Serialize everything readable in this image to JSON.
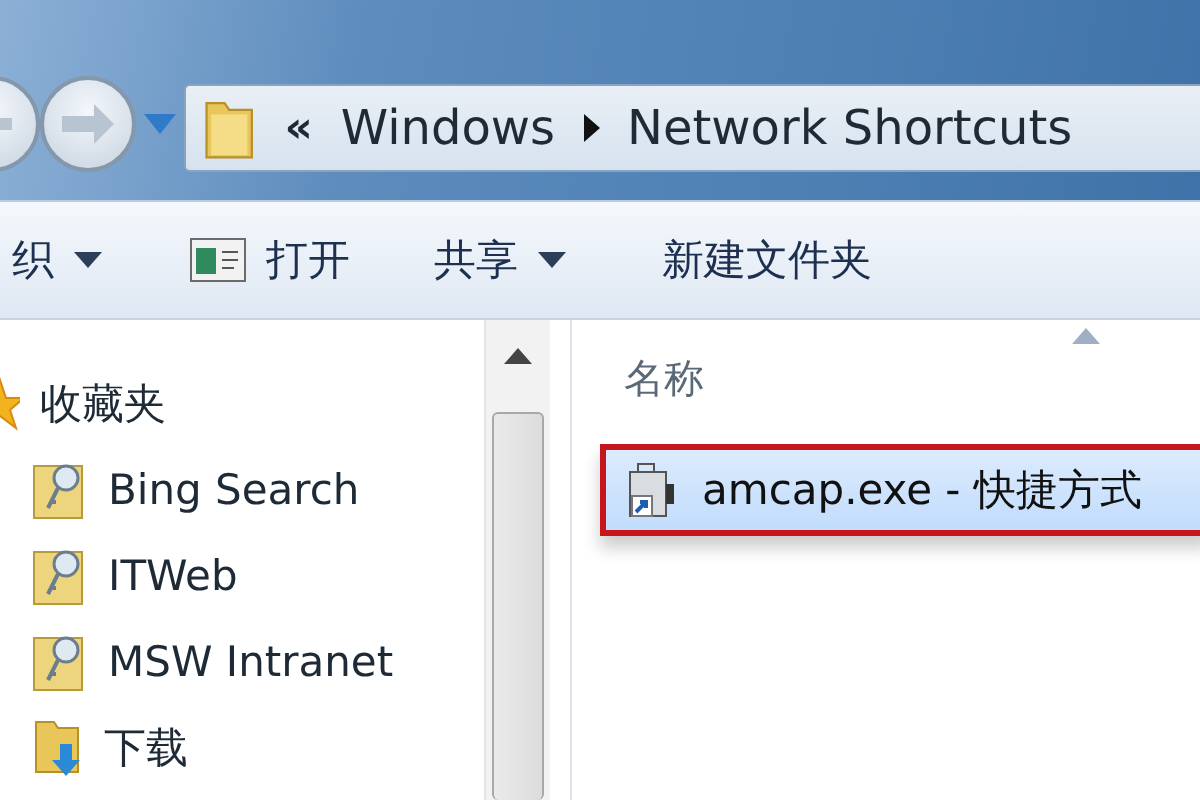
{
  "address_bar": {
    "overflow": "«",
    "crumbs": [
      "Windows",
      "Network Shortcuts"
    ]
  },
  "toolbar": [
    {
      "label": "织",
      "dropdown": true,
      "icon": false
    },
    {
      "label": "打开",
      "dropdown": false,
      "icon": true
    },
    {
      "label": "共享",
      "dropdown": true,
      "icon": false
    },
    {
      "label": "新建文件夹",
      "dropdown": false,
      "icon": false
    }
  ],
  "sidebar": {
    "items": [
      {
        "label": "收藏夹",
        "kind": "favorites",
        "children": [
          {
            "label": "Bing Search",
            "kind": "link"
          },
          {
            "label": "ITWeb",
            "kind": "link"
          },
          {
            "label": "MSW Intranet",
            "kind": "link"
          },
          {
            "label": "下载",
            "kind": "downloads"
          }
        ]
      }
    ]
  },
  "file_list": {
    "columns": [
      "名称"
    ],
    "rows": [
      {
        "name": "amcap.exe - 快捷方式",
        "selected": true
      }
    ]
  }
}
